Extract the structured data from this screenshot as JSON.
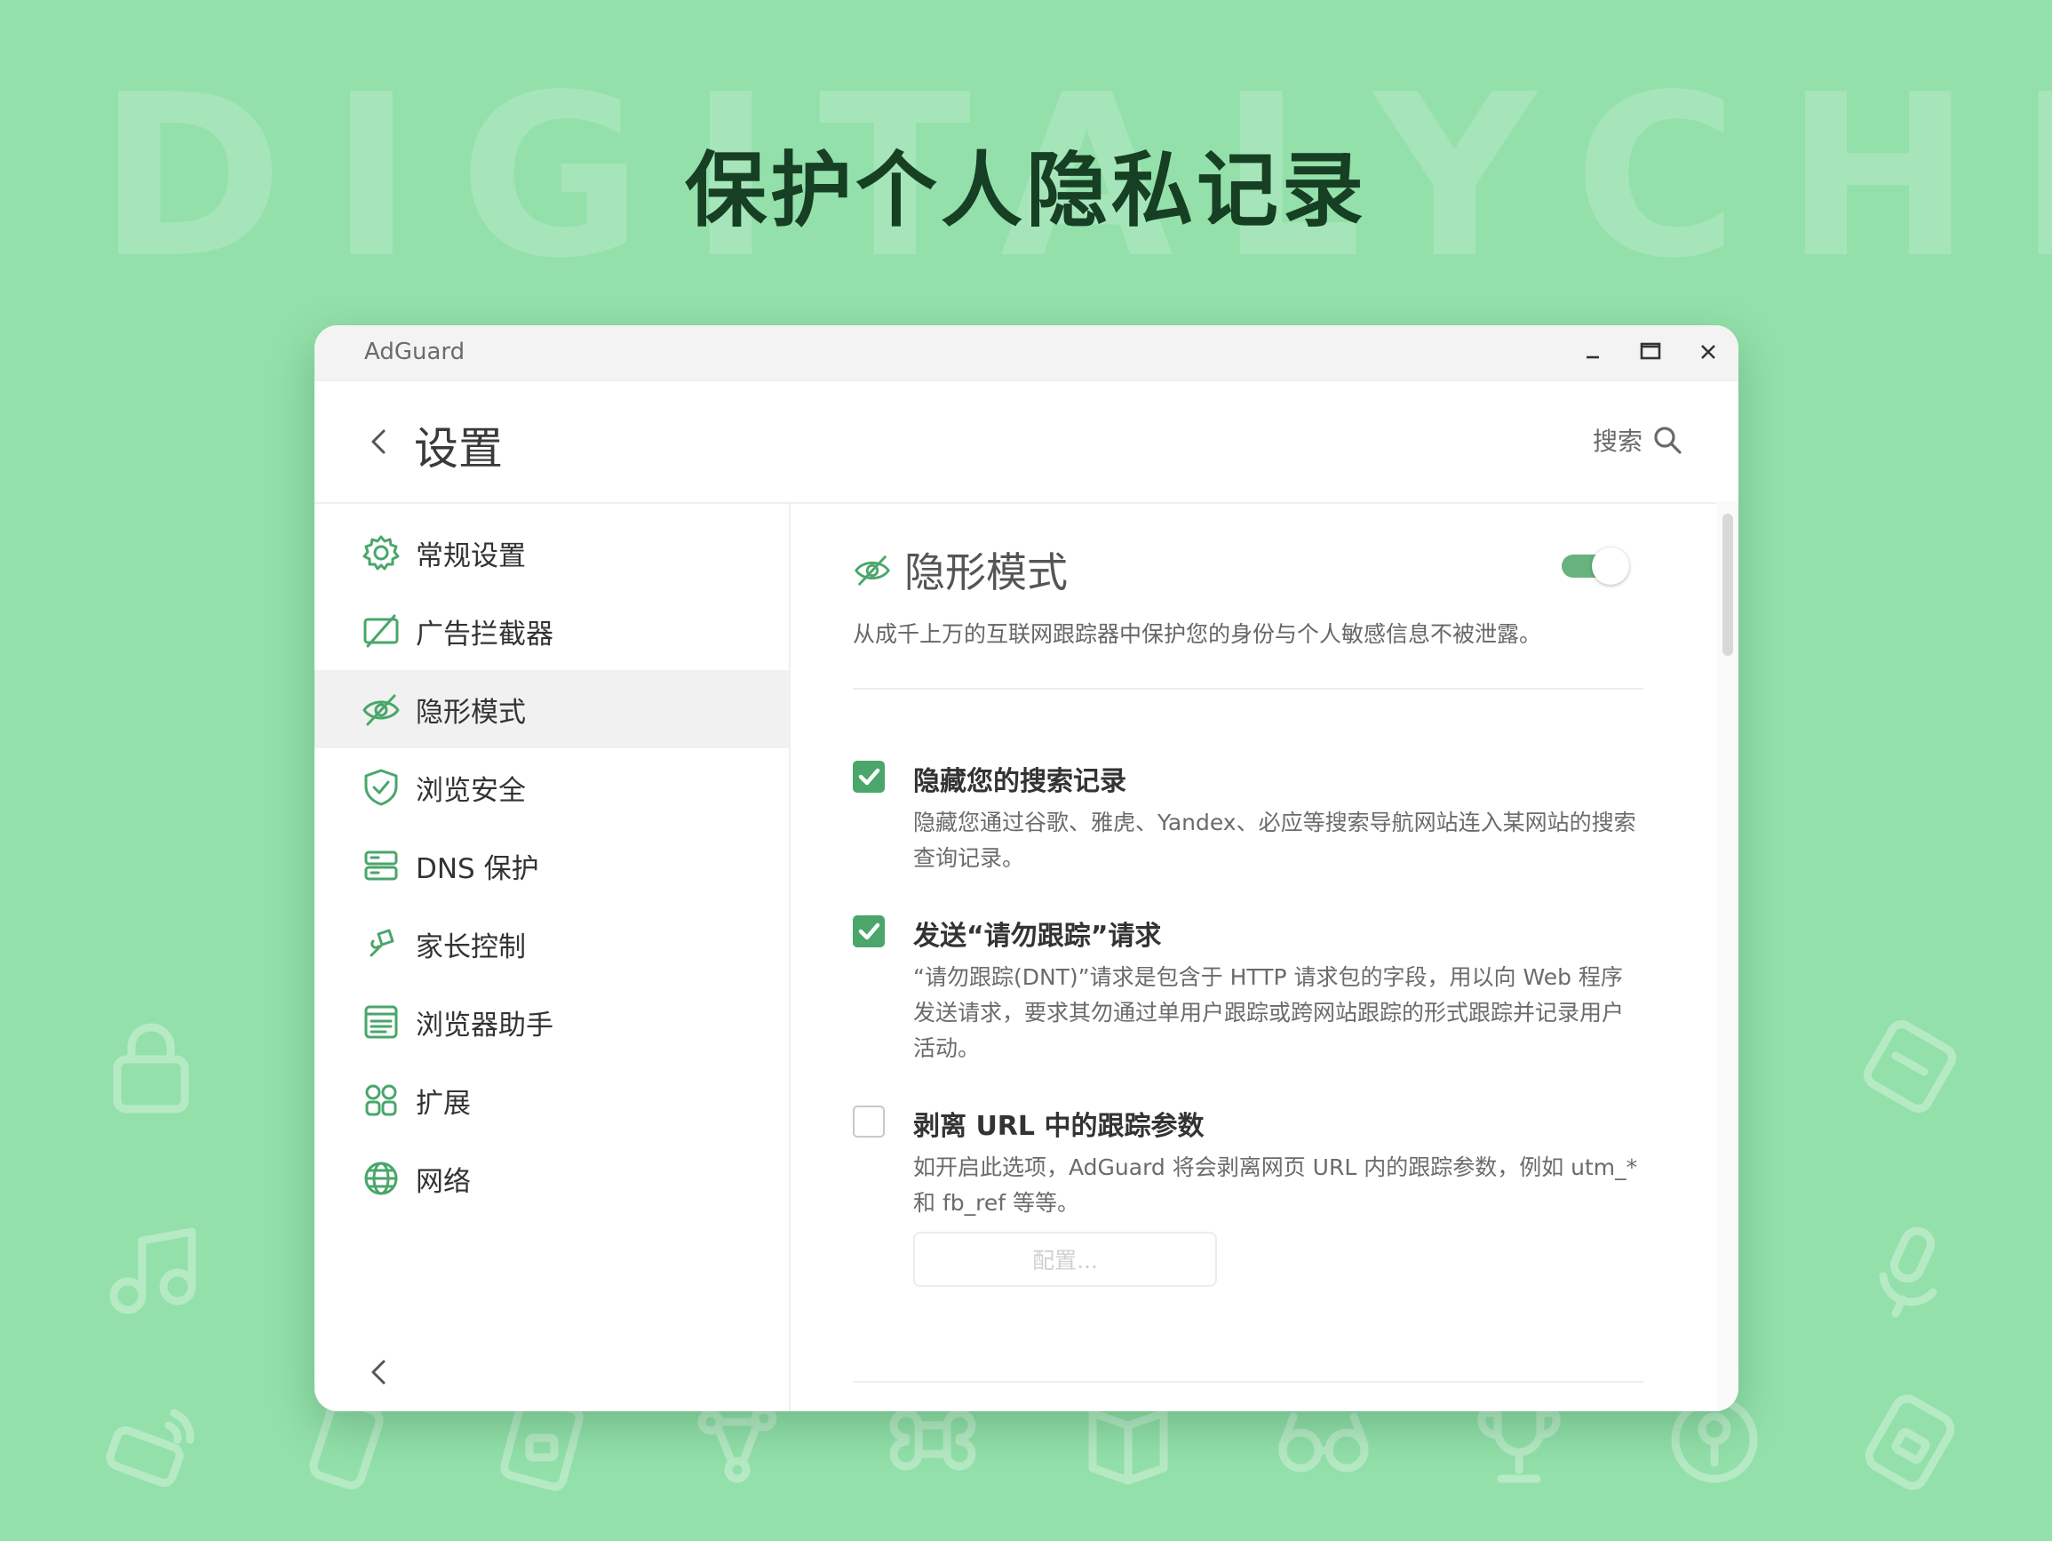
{
  "banner": {
    "watermark": "DIGITALYCHEE",
    "headline": "保护个人隐私记录",
    "background_color": "#93e0aa"
  },
  "window": {
    "app_title": "AdGuard",
    "controls": [
      "minimize-icon",
      "maximize-icon",
      "close-icon"
    ]
  },
  "header": {
    "title": "设置",
    "search_label": "搜索"
  },
  "sidebar": {
    "items": [
      {
        "label": "常规设置",
        "icon": "gear-icon",
        "active": false
      },
      {
        "label": "广告拦截器",
        "icon": "ad-block-icon",
        "active": false
      },
      {
        "label": "隐形模式",
        "icon": "eye-slash-icon",
        "active": true
      },
      {
        "label": "浏览安全",
        "icon": "shield-icon",
        "active": false
      },
      {
        "label": "DNS 保护",
        "icon": "server-icon",
        "active": false
      },
      {
        "label": "家长控制",
        "icon": "kite-icon",
        "active": false
      },
      {
        "label": "浏览器助手",
        "icon": "browser-window-icon",
        "active": false
      },
      {
        "label": "扩展",
        "icon": "grid-icon",
        "active": false
      },
      {
        "label": "网络",
        "icon": "globe-icon",
        "active": false
      }
    ]
  },
  "content": {
    "section_title": "隐形模式",
    "section_enabled": true,
    "section_description": "从成千上万的互联网跟踪器中保护您的身份与个人敏感信息不被泄露。",
    "options": [
      {
        "title": "隐藏您的搜索记录",
        "checked": true,
        "description": "隐藏您通过谷歌、雅虎、Yandex、必应等搜索导航网站连入某网站的搜索查询记录。"
      },
      {
        "title": "发送“请勿跟踪”请求",
        "checked": true,
        "description": "“请勿跟踪(DNT)”请求是包含于 HTTP 请求包的字段，用以向 Web 程序发送请求，要求其勿通过单用户跟踪或跨网站跟踪的形式跟踪并记录用户活动。"
      },
      {
        "title": "剥离 URL 中的跟踪参数",
        "checked": false,
        "description": "如开启此选项，AdGuard 将会剥离网页 URL 内的跟踪参数，例如 utm_* 和 fb_ref 等等。"
      }
    ],
    "config_button": "配置..."
  },
  "colors": {
    "accent": "#4aa66a",
    "headline": "#163f24"
  }
}
